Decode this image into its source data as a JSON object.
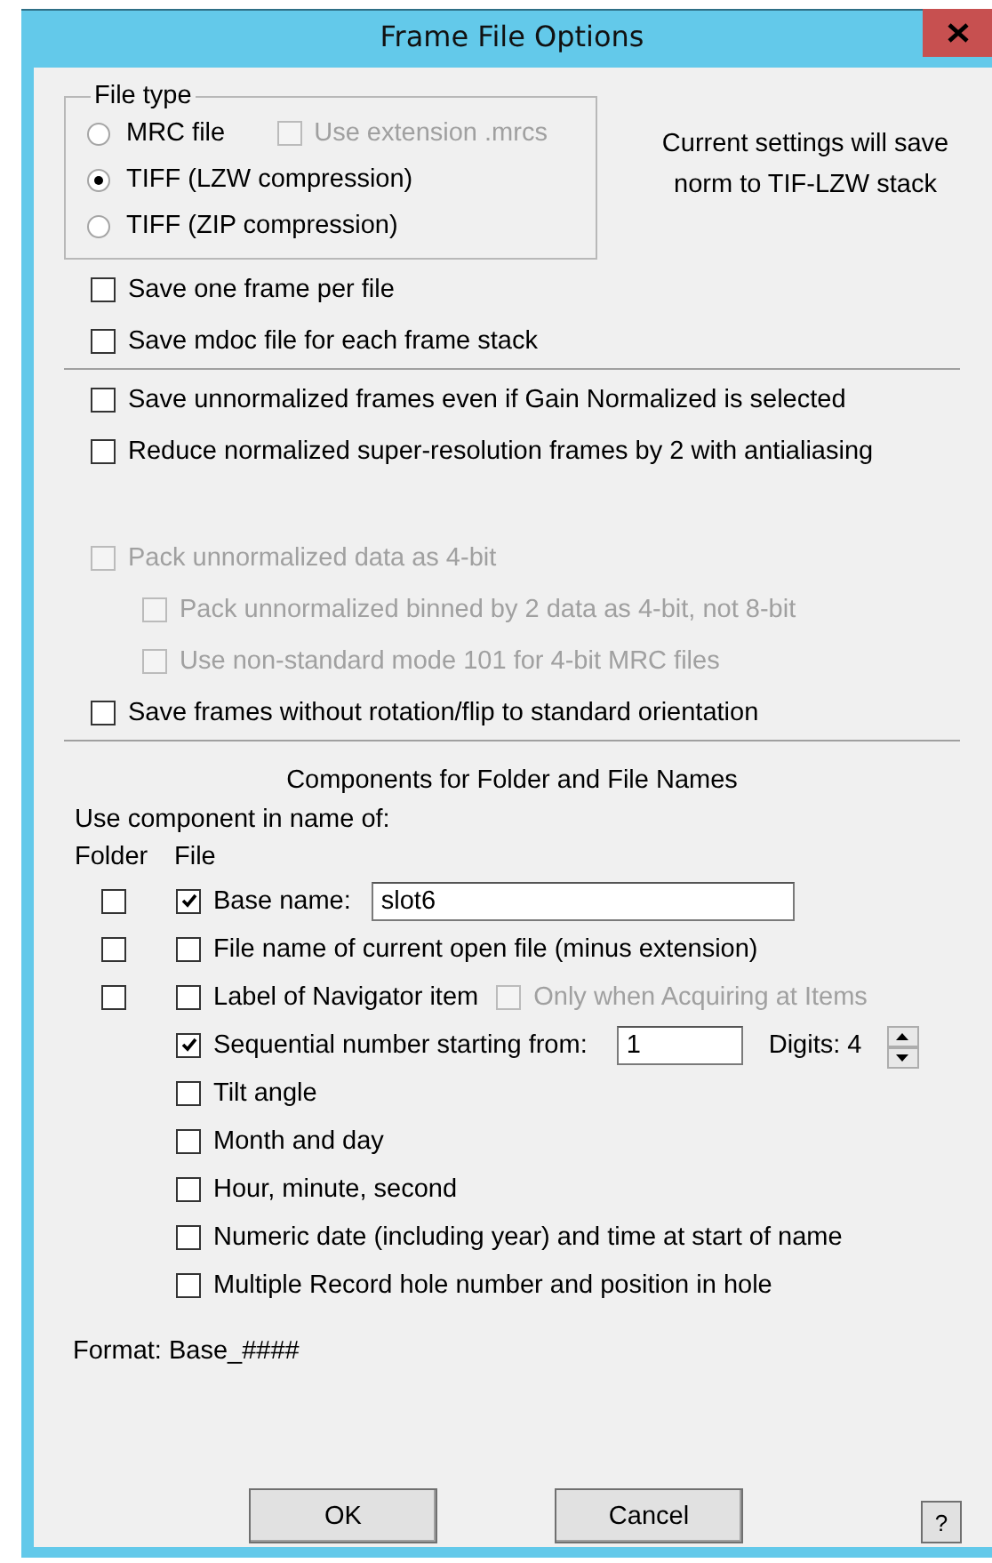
{
  "window": {
    "title": "Frame File Options"
  },
  "file_type": {
    "label": "File type",
    "options": [
      {
        "label": "MRC file",
        "selected": false
      },
      {
        "label": "TIFF (LZW compression)",
        "selected": true
      },
      {
        "label": "TIFF (ZIP compression)",
        "selected": false
      }
    ],
    "use_extension": {
      "label": "Use extension .mrcs",
      "checked": false,
      "disabled": true
    }
  },
  "status_note": "Current settings will save norm to TIF-LZW stack",
  "option_groups": [
    {
      "divider_below": true,
      "items": [
        {
          "label": "Save one frame per file",
          "checked": false,
          "disabled": false
        },
        {
          "label": "Save mdoc file for each frame stack",
          "checked": false,
          "disabled": false
        }
      ]
    },
    {
      "divider_below": false,
      "items": [
        {
          "label": "Save unnormalized frames even if Gain Normalized is selected",
          "checked": false,
          "disabled": false
        },
        {
          "label": "Reduce normalized super-resolution frames by 2 with antialiasing",
          "checked": false,
          "disabled": false
        }
      ]
    },
    {
      "divider_below": true,
      "items": [
        {
          "label": "Pack unnormalized data as 4-bit",
          "checked": false,
          "disabled": true,
          "children": [
            {
              "label": "Pack unnormalized binned by 2 data as 4-bit, not 8-bit",
              "checked": false,
              "disabled": true
            },
            {
              "label": "Use non-standard mode 101 for 4-bit MRC files",
              "checked": false,
              "disabled": true
            }
          ]
        },
        {
          "label": "Save frames without rotation/flip to standard orientation",
          "checked": false,
          "disabled": false
        }
      ]
    }
  ],
  "components": {
    "title": "Components for Folder and File Names",
    "use_label": "Use component in name of:",
    "headers": [
      "Folder",
      "File"
    ],
    "rows": [
      {
        "kind": "field",
        "folder": false,
        "checked": true,
        "label": "Base name:",
        "value": "slot6"
      },
      {
        "kind": "plain",
        "folder": false,
        "checked": false,
        "label": "File name of current open file (minus extension)"
      },
      {
        "kind": "extra",
        "folder": false,
        "checked": false,
        "label": "Label of Navigator item",
        "extra": {
          "label": "Only when Acquiring at Items",
          "checked": false,
          "disabled": true
        }
      },
      {
        "kind": "counter",
        "checked": true,
        "label": "Sequential number starting from:",
        "value": "1",
        "digits": "Digits: 4"
      },
      {
        "kind": "plain",
        "checked": false,
        "label": "Tilt angle"
      },
      {
        "kind": "plain",
        "checked": false,
        "label": "Month and day"
      },
      {
        "kind": "plain",
        "checked": false,
        "label": "Hour, minute, second"
      },
      {
        "kind": "plain",
        "checked": false,
        "label": "Numeric date (including year) and time at start of name"
      },
      {
        "kind": "plain",
        "checked": false,
        "label": "Multiple Record hole number and position in hole"
      }
    ]
  },
  "format": "Format: Base_####",
  "buttons": [
    "OK",
    "Cancel"
  ],
  "help": "?"
}
